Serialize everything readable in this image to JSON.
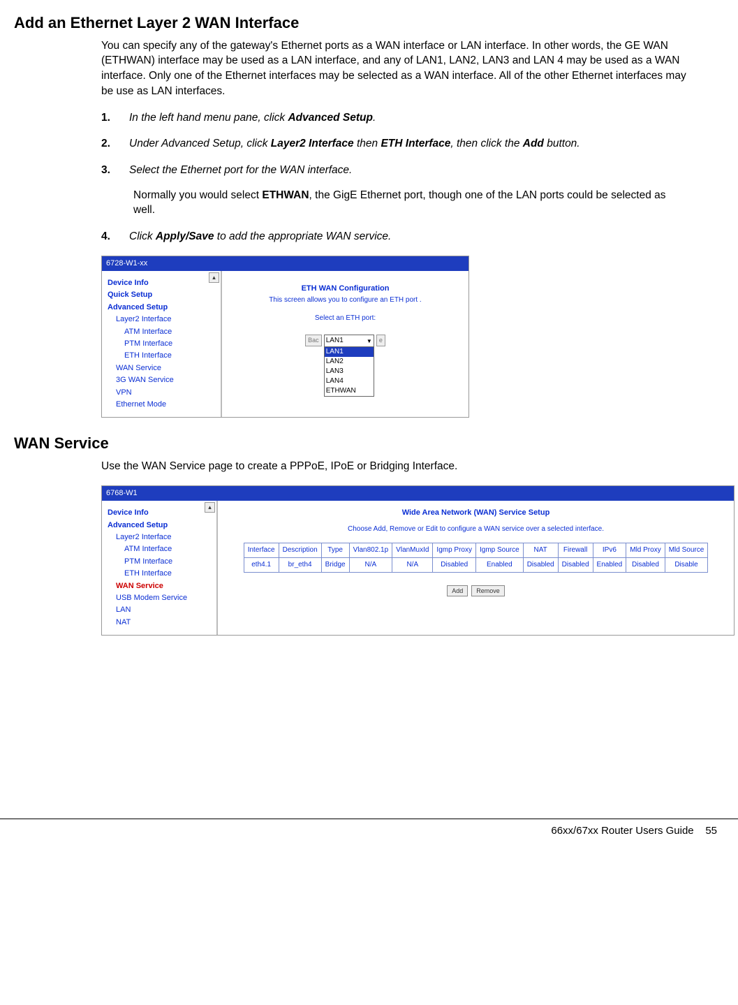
{
  "section1": {
    "title": "Add an Ethernet Layer 2 WAN Interface",
    "intro": "You can specify any of the gateway's Ethernet ports as a WAN interface or LAN interface. In other words, the GE WAN (ETHWAN) interface may be used as a LAN interface, and any of LAN1, LAN2, LAN3 and LAN 4 may be used as a WAN interface. Only one of the Ethernet interfaces may be selected as a WAN interface. All of the other Ethernet interfaces may be use as LAN interfaces.",
    "steps": [
      {
        "num": "1.",
        "pre": "In the left hand menu pane, click ",
        "b1": "Advanced Setup",
        "post": "."
      },
      {
        "num": "2.",
        "pre": "Under Advanced Setup, click ",
        "b1": "Layer2 Interface",
        "mid1": " then ",
        "b2": "ETH Interface",
        "mid2": ", then click the ",
        "b3": "Add",
        "post": " button."
      },
      {
        "num": "3.",
        "pre": "Select the Ethernet port for the WAN interface.",
        "extra_pre": "Normally you would select ",
        "extra_b": "ETHWAN",
        "extra_post": ", the GigE Ethernet port, though one of the LAN ports could be selected as well."
      },
      {
        "num": "4.",
        "pre": "Click ",
        "b1": "Apply/Save",
        "post": " to add the appropriate WAN service."
      }
    ]
  },
  "ui1": {
    "title": "6728-W1-xx",
    "sidebar": [
      "Device Info",
      "Quick Setup",
      "Advanced Setup",
      "Layer2 Interface",
      "ATM Interface",
      "PTM Interface",
      "ETH Interface",
      "WAN Service",
      "3G WAN Service",
      "VPN",
      "Ethernet Mode"
    ],
    "heading": "ETH WAN Configuration",
    "subtext": "This screen allows you to configure an ETH port .",
    "label": "Select an ETH port:",
    "select_top": "LAN1",
    "options": [
      "LAN1",
      "LAN2",
      "LAN3",
      "LAN4",
      "ETHWAN"
    ],
    "behind_l": "Bac",
    "behind_r": "e"
  },
  "section2": {
    "title": "WAN Service",
    "intro": "Use the WAN Service page to create a PPPoE, IPoE or Bridging Interface."
  },
  "ui2": {
    "title": "6768-W1",
    "sidebar": [
      {
        "t": "Device Info",
        "lvl": 0
      },
      {
        "t": "Advanced Setup",
        "lvl": 0
      },
      {
        "t": "Layer2 Interface",
        "lvl": 1
      },
      {
        "t": "ATM Interface",
        "lvl": 2
      },
      {
        "t": "PTM Interface",
        "lvl": 2
      },
      {
        "t": "ETH Interface",
        "lvl": 2
      },
      {
        "t": "WAN Service",
        "lvl": 1,
        "red": true
      },
      {
        "t": "USB Modem Service",
        "lvl": 1
      },
      {
        "t": "LAN",
        "lvl": 1
      },
      {
        "t": "NAT",
        "lvl": 1
      }
    ],
    "heading": "Wide Area Network (WAN) Service Setup",
    "subtext": "Choose Add, Remove or Edit to configure a WAN service over a selected interface.",
    "cols": [
      "Interface",
      "Description",
      "Type",
      "Vlan802.1p",
      "VlanMuxId",
      "Igmp Proxy",
      "Igmp Source",
      "NAT",
      "Firewall",
      "IPv6",
      "Mld Proxy",
      "Mld Source"
    ],
    "row": [
      "eth4.1",
      "br_eth4",
      "Bridge",
      "N/A",
      "N/A",
      "Disabled",
      "Enabled",
      "Disabled",
      "Disabled",
      "Enabled",
      "Disabled",
      "Disable"
    ],
    "btns": [
      "Add",
      "Remove"
    ]
  },
  "footer": {
    "text": "66xx/67xx Router Users Guide",
    "page": "55"
  }
}
